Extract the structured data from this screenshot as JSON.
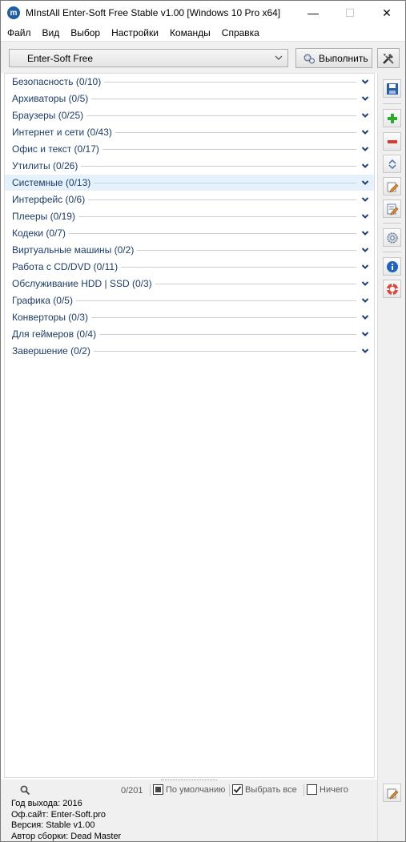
{
  "window": {
    "title": "MInstAll Enter-Soft Free Stable v1.00  [Windows 10 Pro x64]",
    "controls": {
      "minimize": "—",
      "maximize": "☐",
      "close": "✕"
    }
  },
  "menu": [
    "Файл",
    "Вид",
    "Выбор",
    "Настройки",
    "Команды",
    "Справка"
  ],
  "toolbar": {
    "profile_selected": "Enter-Soft Free",
    "run_label": "Выполнить"
  },
  "categories": [
    {
      "label": "Безопасность  (0/10)"
    },
    {
      "label": "Архиваторы  (0/5)"
    },
    {
      "label": "Браузеры  (0/25)"
    },
    {
      "label": "Интернет и сети  (0/43)"
    },
    {
      "label": "Офис и текст  (0/17)"
    },
    {
      "label": "Утилиты  (0/26)"
    },
    {
      "label": "Системные  (0/13)",
      "selected": true
    },
    {
      "label": "Интерфейс  (0/6)"
    },
    {
      "label": "Плееры  (0/19)"
    },
    {
      "label": "Кодеки  (0/7)"
    },
    {
      "label": "Виртуальные машины  (0/2)"
    },
    {
      "label": "Работа с CD/DVD  (0/11)"
    },
    {
      "label": "Обслуживание HDD | SSD  (0/3)"
    },
    {
      "label": "Графика  (0/5)"
    },
    {
      "label": "Конверторы  (0/3)"
    },
    {
      "label": "Для геймеров  (0/4)"
    },
    {
      "label": "Завершение  (0/2)"
    }
  ],
  "status": {
    "count": "0/201",
    "default_label": "По умолчанию",
    "select_all_label": "Выбрать все",
    "none_label": "Ничего"
  },
  "info": {
    "year": "Год выхода: 2016",
    "site": "Оф.сайт: Enter-Soft.pro",
    "version": "Версия: Stable v1.00",
    "author": "Автор сборки: Dead Master"
  },
  "colors": {
    "category_text": "#1c3c6e",
    "chevron": "#1e3f7a",
    "selected_row": "#e5f1fb",
    "add": "#2ea82e",
    "remove": "#d93a2e",
    "info": "#1c63c4"
  }
}
